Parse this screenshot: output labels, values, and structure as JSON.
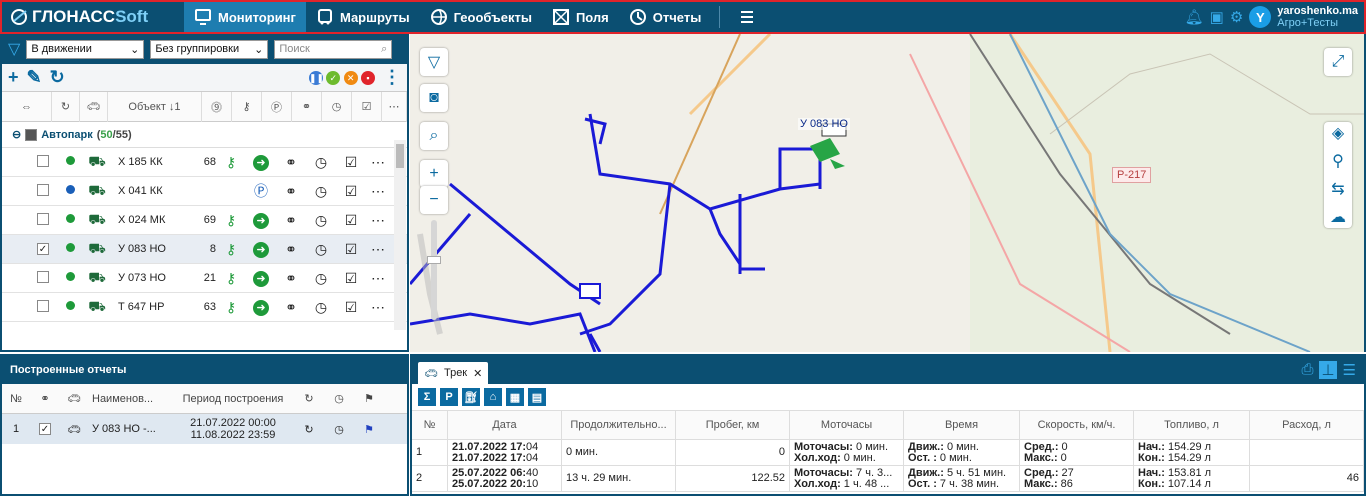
{
  "header": {
    "logo_a": "ГЛОНАСС",
    "logo_b": "Soft",
    "nav": [
      {
        "label": "Мониторинг",
        "icon": "monitor-icon"
      },
      {
        "label": "Маршруты",
        "icon": "bus-icon"
      },
      {
        "label": "Геообъекты",
        "icon": "globe-icon"
      },
      {
        "label": "Поля",
        "icon": "field-icon"
      },
      {
        "label": "Отчеты",
        "icon": "report-icon"
      }
    ],
    "user": {
      "initial": "Y",
      "name": "yaroshenko.ma",
      "role": "Агро+Тесты"
    }
  },
  "left": {
    "filter_select": "В движении",
    "group_select": "Без группировки",
    "search_placeholder": "Поиск",
    "object_col": "Объект ↓1",
    "group": {
      "name": "Автопарк",
      "count_a": "50",
      "count_b": "55"
    },
    "rows": [
      {
        "name": "Х 185 КК",
        "speed": "68",
        "status": "green",
        "checked": false
      },
      {
        "name": "Х 041 КК",
        "speed": "",
        "status": "blue",
        "checked": false
      },
      {
        "name": "Х 024 МК",
        "speed": "69",
        "status": "green",
        "checked": false
      },
      {
        "name": "У 083 НО",
        "speed": "8",
        "status": "green",
        "checked": true
      },
      {
        "name": "У 073 НО",
        "speed": "21",
        "status": "green",
        "checked": false
      },
      {
        "name": "Т 647 НР",
        "speed": "63",
        "status": "green",
        "checked": false
      }
    ]
  },
  "reports": {
    "title": "Построенные отчеты",
    "cols": {
      "num": "№",
      "name": "Наименов...",
      "period": "Период построения"
    },
    "row": {
      "num": "1",
      "name": "У 083 НО -...",
      "from": "21.07.2022 00:00",
      "to": "11.08.2022 23:59"
    }
  },
  "map": {
    "vehicle_label": "У 083 НО",
    "road_label": "Р-217"
  },
  "track": {
    "tab": "Трек",
    "cols": [
      "№",
      "Дата",
      "Продолжительно...",
      "Пробег, км",
      "Моточасы",
      "Время",
      "Скорость, км/ч.",
      "Топливо, л",
      "Расход, л"
    ],
    "rows": [
      {
        "num": "1",
        "date1": "21.07.2022 17:04",
        "date2": "21.07.2022 17:04",
        "dur": "0 мин.",
        "km": "0",
        "m1": "Моточасы: 0 мин.",
        "m2": "Хол.ход: 0 мин.",
        "t1": "Движ.: 0 мин.",
        "t2": "Ост. : 0 мин.",
        "s1": "Сред.: 0",
        "s2": "Макс.: 0",
        "f1": "Нач.: 154.29 л",
        "f2": "Кон.: 154.29 л",
        "c": ""
      },
      {
        "num": "2",
        "date1": "25.07.2022 06:40",
        "date2": "25.07.2022 20:10",
        "dur": "13 ч. 29 мин.",
        "km": "122.52",
        "m1": "Моточасы: 7 ч. 3...",
        "m2": "Хол.ход: 1 ч. 48 ...",
        "t1": "Движ.: 5 ч. 51 мин.",
        "t2": "Ост. : 7 ч. 38 мин.",
        "s1": "Сред.: 27",
        "s2": "Макс.: 86",
        "f1": "Нач.: 153.81 л",
        "f2": "Кон.: 107.14 л",
        "c": "46"
      }
    ]
  }
}
